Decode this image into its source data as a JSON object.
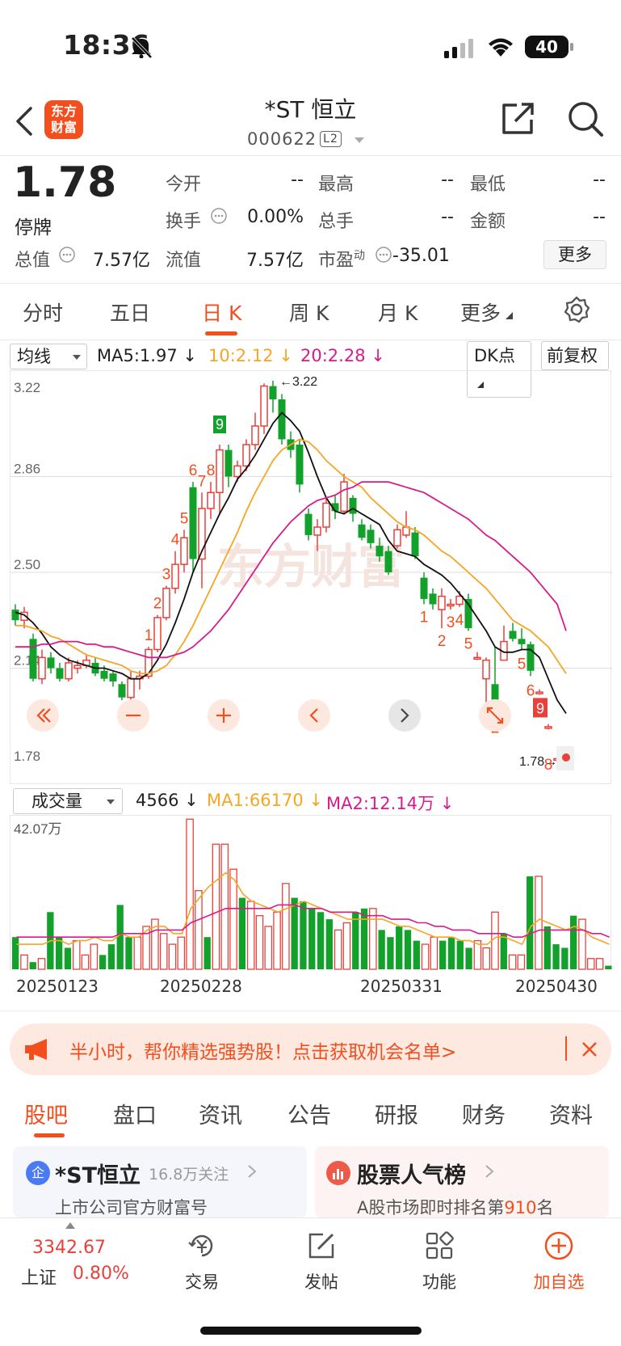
{
  "status": {
    "time": "18:36",
    "battery": "40"
  },
  "header": {
    "back_icon": "chevron-left-icon",
    "logo_line1": "东方",
    "logo_line2": "财富",
    "title": "*ST 恒立",
    "code": "000622",
    "level": "L2"
  },
  "quote": {
    "price": "1.78",
    "status": "停牌",
    "open_label": "今开",
    "open_value": "--",
    "high_label": "最高",
    "high_value": "--",
    "low_label": "最低",
    "low_value": "--",
    "turnover_label": "换手",
    "turnover_value": "0.00%",
    "volume_label": "总手",
    "volume_value": "--",
    "amount_label": "金额",
    "amount_value": "--",
    "mktcap_label": "总值",
    "mktcap_value": "7.57亿",
    "float_label": "流值",
    "float_value": "7.57亿",
    "pe_label": "市盈",
    "pe_sup": "动",
    "pe_value": "-35.01",
    "more_label": "更多"
  },
  "tabs": [
    "分时",
    "五日",
    "日 K",
    "周 K",
    "月 K",
    "更多"
  ],
  "active_tab": "日 K",
  "ma_bar": {
    "selector": "均线",
    "ma5": "MA5:1.97",
    "ma10": "10:2.12",
    "ma20": "20:2.28",
    "dk": "DK点",
    "adjust": "前复权"
  },
  "colors": {
    "up": "#e8413b",
    "down": "#12a12a",
    "ma5": "#111111",
    "ma10": "#f5a623",
    "ma20": "#d81b8c",
    "accent": "#f24e1e"
  },
  "chart_data": {
    "type": "candlestick",
    "title": "",
    "ylim": [
      1.78,
      3.22
    ],
    "y_ticks": [
      "3.22",
      "2.86",
      "2.50",
      "2.14",
      "1.78"
    ],
    "max_label": "3.22",
    "last_label": "1.78",
    "watermark": "东方财富",
    "td_up_labels": [
      "1",
      "2",
      "3",
      "4",
      "5",
      "6",
      "7",
      "8",
      "9"
    ],
    "td_down_labels_a": [
      "1",
      "2",
      "3",
      "4",
      "5",
      "6",
      "7",
      "8",
      "9"
    ],
    "td_down_labels_b": [
      "1",
      "2",
      "3",
      "4",
      "5"
    ],
    "candles": [
      [
        2.36,
        2.32,
        2.38,
        2.3
      ],
      [
        2.32,
        2.35,
        2.37,
        2.29
      ],
      [
        2.25,
        2.1,
        2.27,
        2.09
      ],
      [
        2.1,
        2.18,
        2.21,
        2.08
      ],
      [
        2.18,
        2.14,
        2.2,
        2.12
      ],
      [
        2.14,
        2.1,
        2.16,
        2.09
      ],
      [
        2.1,
        2.16,
        2.18,
        2.09
      ],
      [
        2.14,
        2.15,
        2.17,
        2.12
      ],
      [
        2.15,
        2.17,
        2.19,
        2.14
      ],
      [
        2.16,
        2.12,
        2.18,
        2.11
      ],
      [
        2.13,
        2.1,
        2.15,
        2.09
      ],
      [
        2.12,
        2.09,
        2.13,
        2.07
      ],
      [
        2.08,
        2.03,
        2.09,
        2.02
      ],
      [
        2.03,
        2.1,
        2.13,
        2.01
      ],
      [
        2.1,
        2.11,
        2.13,
        2.06
      ],
      [
        2.11,
        2.21,
        2.22,
        2.1
      ],
      [
        2.21,
        2.33,
        2.34,
        2.2
      ],
      [
        2.33,
        2.44,
        2.45,
        2.32
      ],
      [
        2.44,
        2.53,
        2.58,
        2.42
      ],
      [
        2.53,
        2.63,
        2.66,
        2.5
      ],
      [
        2.82,
        2.55,
        2.84,
        2.5
      ],
      [
        2.55,
        2.74,
        2.8,
        2.44
      ],
      [
        2.74,
        2.8,
        2.84,
        2.7
      ],
      [
        2.8,
        2.96,
        2.98,
        2.72
      ],
      [
        2.96,
        2.86,
        2.98,
        2.82
      ],
      [
        2.86,
        2.9,
        2.92,
        2.84
      ],
      [
        2.9,
        2.98,
        3.0,
        2.88
      ],
      [
        2.98,
        3.05,
        3.1,
        2.96
      ],
      [
        3.05,
        3.2,
        3.21,
        3.02
      ],
      [
        3.2,
        3.15,
        3.22,
        3.1
      ],
      [
        3.15,
        3.0,
        3.17,
        2.98
      ],
      [
        3.0,
        2.96,
        3.03,
        2.93
      ],
      [
        2.98,
        2.83,
        3.0,
        2.8
      ],
      [
        2.72,
        2.64,
        2.74,
        2.62
      ],
      [
        2.64,
        2.67,
        2.7,
        2.58
      ],
      [
        2.67,
        2.76,
        2.78,
        2.65
      ],
      [
        2.76,
        2.73,
        2.79,
        2.7
      ],
      [
        2.73,
        2.84,
        2.87,
        2.72
      ],
      [
        2.78,
        2.72,
        2.79,
        2.69
      ],
      [
        2.68,
        2.63,
        2.7,
        2.62
      ],
      [
        2.66,
        2.61,
        2.68,
        2.59
      ],
      [
        2.6,
        2.56,
        2.63,
        2.54
      ],
      [
        2.58,
        2.5,
        2.6,
        2.49
      ],
      [
        2.6,
        2.66,
        2.68,
        2.59
      ],
      [
        2.64,
        2.67,
        2.73,
        2.63
      ],
      [
        2.65,
        2.56,
        2.67,
        2.55
      ],
      [
        2.48,
        2.4,
        2.5,
        2.38
      ],
      [
        2.42,
        2.38,
        2.44,
        2.36
      ],
      [
        2.36,
        2.41,
        2.44,
        2.29
      ],
      [
        2.38,
        2.38,
        2.4,
        2.36
      ],
      [
        2.38,
        2.41,
        2.43,
        2.37
      ],
      [
        2.4,
        2.29,
        2.42,
        2.28
      ],
      [
        2.18,
        2.18,
        2.2,
        2.17
      ],
      [
        2.1,
        2.17,
        2.18,
        1.97
      ],
      [
        2.08,
        1.97,
        2.22,
        1.97
      ],
      [
        2.17,
        2.24,
        2.3,
        2.17
      ],
      [
        2.28,
        2.25,
        2.31,
        2.24
      ],
      [
        2.25,
        2.23,
        2.29,
        2.21
      ],
      [
        2.23,
        2.13,
        2.24,
        2.11
      ],
      [
        2.05,
        2.05,
        2.06,
        2.04
      ],
      [
        1.92,
        1.92,
        1.93,
        1.91
      ],
      [
        1.8,
        1.8,
        1.81,
        1.79
      ],
      [
        1.79,
        1.78,
        1.8,
        1.78
      ]
    ],
    "ma5": [
      2.35,
      2.34,
      2.31,
      2.27,
      2.22,
      2.19,
      2.17,
      2.16,
      2.15,
      2.14,
      2.14,
      2.13,
      2.12,
      2.1,
      2.1,
      2.12,
      2.17,
      2.23,
      2.31,
      2.4,
      2.5,
      2.58,
      2.65,
      2.72,
      2.78,
      2.85,
      2.89,
      2.94,
      3.0,
      3.06,
      3.1,
      3.07,
      3.03,
      2.95,
      2.86,
      2.78,
      2.73,
      2.72,
      2.74,
      2.72,
      2.7,
      2.68,
      2.62,
      2.58,
      2.57,
      2.56,
      2.53,
      2.51,
      2.49,
      2.46,
      2.42,
      2.38,
      2.33,
      2.28,
      2.22,
      2.2,
      2.2,
      2.21,
      2.21,
      2.18,
      2.1,
      2.02,
      1.97
    ],
    "ma10": [
      2.3,
      2.3,
      2.29,
      2.28,
      2.26,
      2.25,
      2.23,
      2.21,
      2.19,
      2.18,
      2.17,
      2.16,
      2.15,
      2.13,
      2.12,
      2.12,
      2.13,
      2.15,
      2.19,
      2.24,
      2.3,
      2.37,
      2.44,
      2.51,
      2.58,
      2.65,
      2.73,
      2.8,
      2.86,
      2.92,
      2.96,
      2.98,
      3.0,
      2.99,
      2.96,
      2.92,
      2.89,
      2.86,
      2.84,
      2.82,
      2.78,
      2.75,
      2.72,
      2.69,
      2.67,
      2.66,
      2.64,
      2.61,
      2.58,
      2.56,
      2.53,
      2.5,
      2.47,
      2.44,
      2.4,
      2.36,
      2.32,
      2.3,
      2.28,
      2.25,
      2.22,
      2.17,
      2.12
    ],
    "ma20": [
      2.22,
      2.22,
      2.22,
      2.23,
      2.23,
      2.24,
      2.24,
      2.24,
      2.23,
      2.23,
      2.22,
      2.22,
      2.21,
      2.2,
      2.19,
      2.18,
      2.18,
      2.18,
      2.19,
      2.2,
      2.22,
      2.25,
      2.28,
      2.32,
      2.36,
      2.41,
      2.46,
      2.51,
      2.56,
      2.61,
      2.65,
      2.69,
      2.72,
      2.75,
      2.77,
      2.78,
      2.79,
      2.81,
      2.82,
      2.84,
      2.84,
      2.84,
      2.84,
      2.83,
      2.82,
      2.81,
      2.8,
      2.78,
      2.76,
      2.74,
      2.72,
      2.7,
      2.67,
      2.64,
      2.62,
      2.59,
      2.56,
      2.53,
      2.5,
      2.46,
      2.42,
      2.38,
      2.28
    ],
    "volume": {
      "ylim": [
        0,
        42.07
      ],
      "y_max_label": "42.07万",
      "unit": "万",
      "values": [
        9,
        4,
        2,
        3,
        16,
        9,
        6,
        8,
        4,
        7,
        4,
        7,
        18,
        9,
        9,
        12,
        14,
        10,
        7,
        9,
        42,
        22,
        9,
        35,
        35,
        28,
        20,
        19,
        15,
        12,
        16,
        24,
        20,
        19,
        17,
        16,
        14,
        11,
        13,
        16,
        17,
        17,
        11,
        9,
        12,
        11,
        8,
        7,
        9,
        8,
        9,
        8,
        6,
        8,
        6,
        16,
        10,
        4,
        4,
        26,
        26,
        12,
        7,
        6,
        15,
        14,
        3,
        3,
        1
      ],
      "ma1": [
        7,
        7,
        7,
        7,
        8,
        8,
        7,
        8,
        8,
        9,
        8,
        8,
        10,
        9,
        9,
        11,
        12,
        12,
        10,
        10,
        17,
        20,
        23,
        25,
        27,
        25,
        21,
        19,
        18,
        17,
        16,
        17,
        18,
        19,
        18,
        17,
        16,
        15,
        14,
        14,
        14,
        14,
        14,
        13,
        12,
        12,
        11,
        10,
        9,
        9,
        9,
        8,
        8,
        7,
        7,
        9,
        9,
        8,
        7,
        12,
        14,
        13,
        12,
        11,
        12,
        11,
        9,
        8,
        7
      ],
      "ma2": [
        9,
        9,
        9,
        9,
        9,
        9,
        9,
        9,
        9,
        9,
        9,
        9,
        10,
        10,
        10,
        10,
        11,
        11,
        11,
        11,
        13,
        14,
        15,
        16,
        17,
        17,
        17,
        17,
        17,
        17,
        18,
        18,
        18,
        17,
        17,
        17,
        16,
        16,
        16,
        16,
        15,
        15,
        15,
        14,
        14,
        14,
        13,
        13,
        12,
        12,
        11,
        11,
        11,
        10,
        10,
        10,
        10,
        9,
        9,
        10,
        11,
        11,
        11,
        11,
        11,
        11,
        10,
        10,
        9
      ]
    },
    "dates": [
      "20250123",
      "20250228",
      "20250331",
      "20250430"
    ]
  },
  "vol_bar": {
    "selector": "成交量",
    "vol": "4566",
    "ma1": "MA1:66170",
    "ma2": "MA2:12.14万"
  },
  "banner": {
    "text": "半小时，帮你精选强势股！点击获取机会名单>"
  },
  "bottom_tabs": [
    "股吧",
    "盘口",
    "资讯",
    "公告",
    "研报",
    "财务",
    "资料"
  ],
  "cards": {
    "left_title": "*ST恒立",
    "left_badge": "16.8万关注",
    "left_sub": "上市公司官方财富号",
    "right_title": "股票人气榜",
    "right_sub_pre": "A股市场即时排名第",
    "right_rank": "910",
    "right_sub_post": "名"
  },
  "bottom_nav": {
    "index_value": "3342.67",
    "index_name": "上证",
    "index_change": "0.80%",
    "trade": "交易",
    "post": "发帖",
    "func": "功能",
    "add": "加自选"
  }
}
